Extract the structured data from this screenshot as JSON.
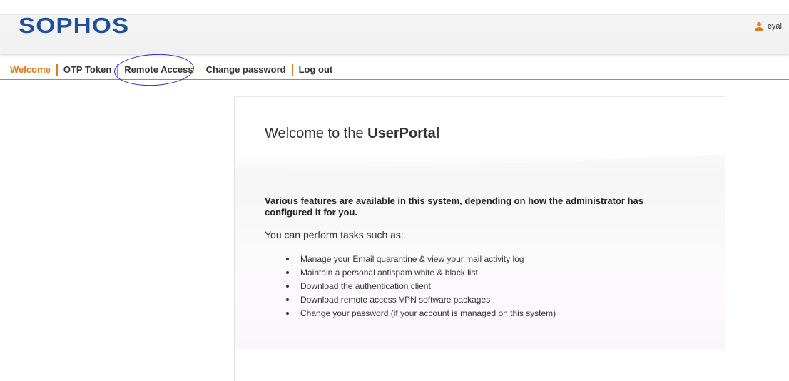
{
  "header": {
    "logo": "SOPHOS",
    "username": "eyal"
  },
  "nav": {
    "items": [
      {
        "label": "Welcome"
      },
      {
        "label": "OTP Token"
      },
      {
        "label": "Remote Access"
      },
      {
        "label": "Change password"
      },
      {
        "label": "Log out"
      }
    ]
  },
  "main": {
    "title_prefix": "Welcome to the ",
    "title_bold": "UserPortal",
    "intro": "Various features are available in this system, depending on how the administrator has configured it for you.",
    "tasks_heading": "You can perform tasks such as:",
    "tasks": [
      "Manage your Email quarantine & view your mail activity log",
      "Maintain a personal antispam white & black list",
      "Download the authentication client",
      "Download remote access VPN software packages",
      "Change your password (if your account is managed on this system)"
    ]
  },
  "colors": {
    "brand_blue": "#1d4f9c",
    "accent_orange": "#e07b17",
    "annotation_circle": "#2b2bd6"
  }
}
